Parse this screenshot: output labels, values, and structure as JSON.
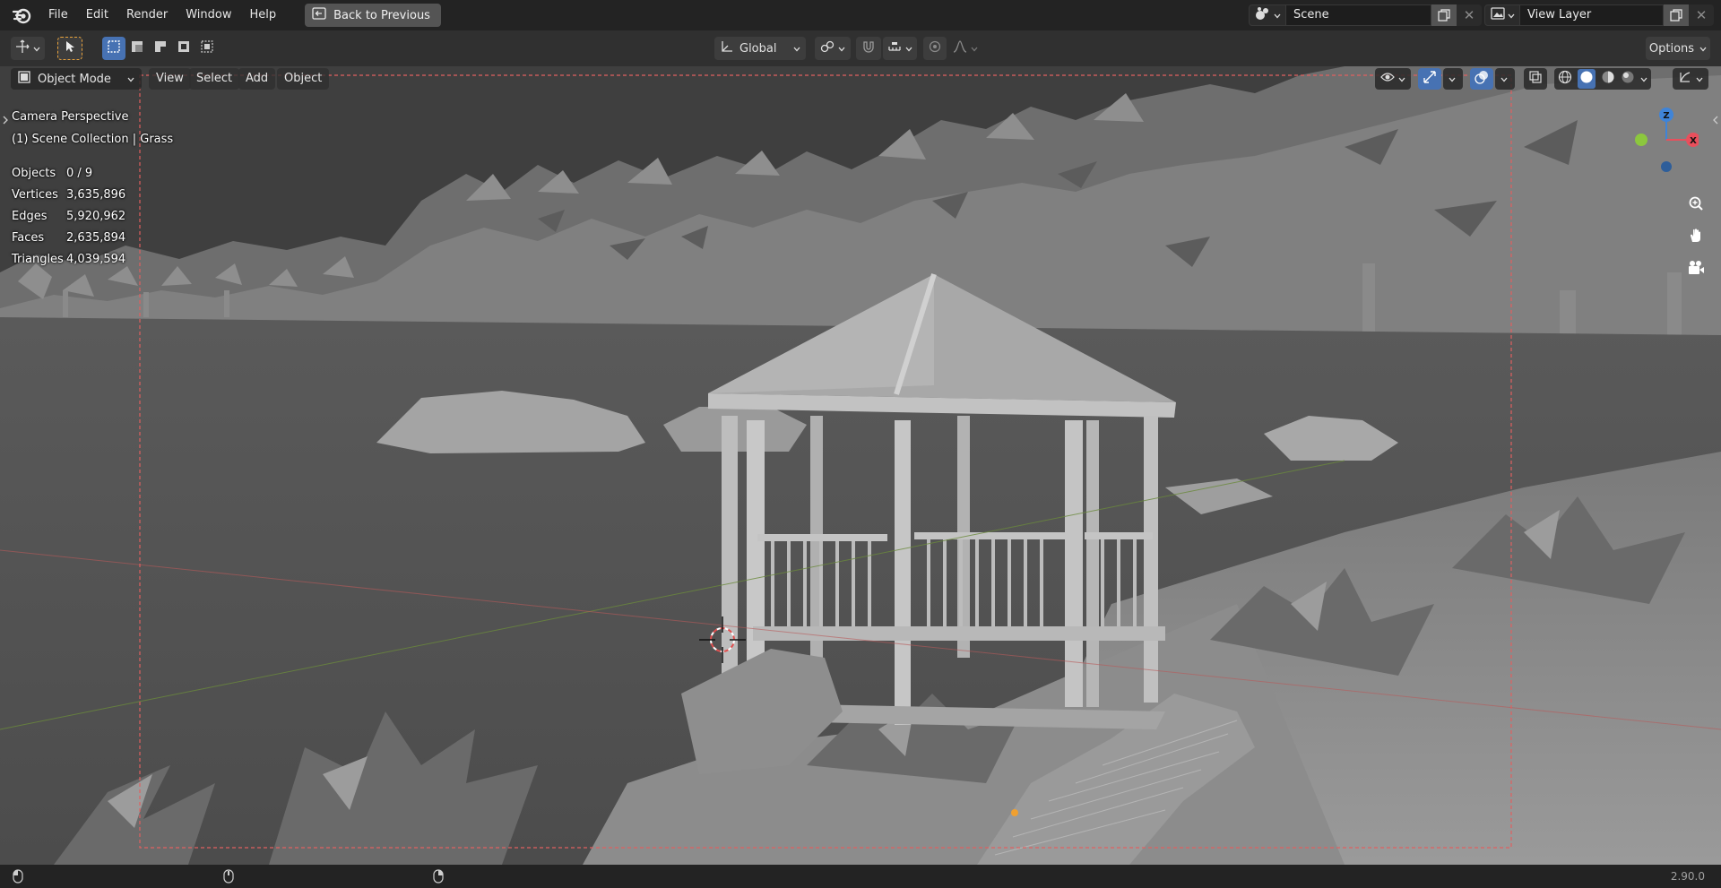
{
  "app": {
    "logo_icon": "blender-logo-icon"
  },
  "topbar": {
    "menus": [
      "File",
      "Edit",
      "Render",
      "Window",
      "Help"
    ],
    "back_button": "Back to Previous",
    "scene": "Scene",
    "view_layer": "View Layer"
  },
  "toolheader": {
    "transform_orientation": "Global",
    "options": "Options"
  },
  "viewport_header": {
    "mode": "Object Mode",
    "menus": [
      "View",
      "Select",
      "Add",
      "Object"
    ]
  },
  "overlay": {
    "perspective": "Camera Perspective",
    "collection": "(1) Scene Collection | Grass",
    "stats": [
      {
        "label": "Objects",
        "value": "0 / 9"
      },
      {
        "label": "Vertices",
        "value": "3,635,896"
      },
      {
        "label": "Edges",
        "value": "5,920,962"
      },
      {
        "label": "Faces",
        "value": "2,635,894"
      },
      {
        "label": "Triangles",
        "value": "4,039,594"
      }
    ]
  },
  "gizmo": {
    "z": "Z",
    "x": "X"
  },
  "statusbar": {
    "version": "2.90.0"
  },
  "colors": {
    "accent": "#4772b3",
    "gizmo_x": "#e84f5c",
    "gizmo_y": "#8cc73e",
    "gizmo_z": "#3f84d8",
    "camera_frame": "#e06060"
  }
}
